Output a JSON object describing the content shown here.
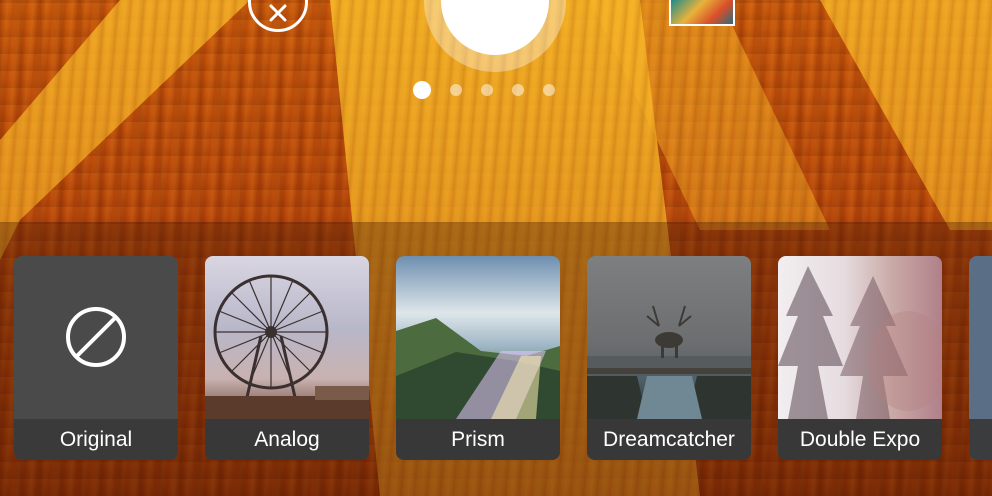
{
  "camera": {
    "close_icon": "close-icon",
    "shutter_icon": "shutter-button",
    "page_indicator": {
      "count": 5,
      "active_index": 0
    }
  },
  "filters": [
    {
      "label": "Original",
      "icon": "none-icon",
      "selected": true
    },
    {
      "label": "Analog",
      "icon": "ferris-wheel-image"
    },
    {
      "label": "Prism",
      "icon": "mountain-lake-image"
    },
    {
      "label": "Dreamcatcher",
      "icon": "deer-in-fog-image"
    },
    {
      "label": "Double Expo",
      "icon": "double-exposure-image"
    }
  ],
  "colors": {
    "accent": "#ffffff",
    "card_label_bg": "#373737",
    "tray_tint": "#3c1405"
  }
}
